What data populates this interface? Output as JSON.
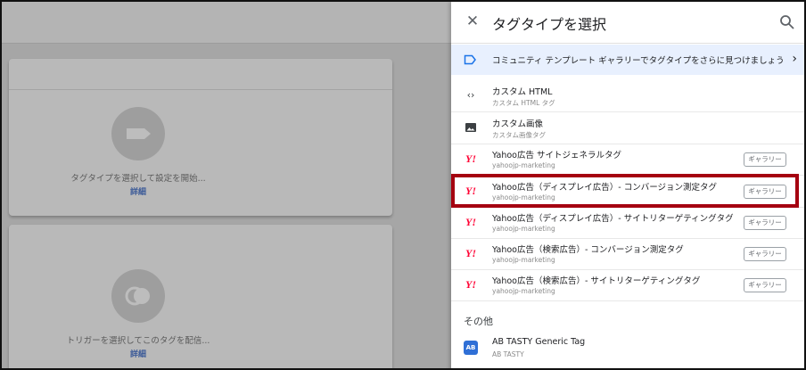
{
  "workspace": {
    "tag_config_card": {
      "text": "タグタイプを選択して設定を開始...",
      "link": "詳細"
    },
    "trigger_card": {
      "text": "トリガーを選択してこのタグを配信...",
      "link": "詳細"
    }
  },
  "panel": {
    "title": "タグタイプを選択",
    "banner": "コミュニティ テンプレート ギャラリーでタグタイプをさらに見つけましょう",
    "items": [
      {
        "name": "カスタム HTML",
        "sub": "カスタム HTML タグ",
        "icon": "code-icon"
      },
      {
        "name": "カスタム画像",
        "sub": "カスタム画像タグ",
        "icon": "image-icon"
      },
      {
        "name": "Yahoo広告 サイトジェネラルタグ",
        "sub": "yahoojp-marketing",
        "icon": "yahoo-icon",
        "badge": "ギャラリー"
      },
      {
        "name": "Yahoo広告（ディスプレイ広告）- コンバージョン測定タグ",
        "sub": "yahoojp-marketing",
        "icon": "yahoo-icon",
        "badge": "ギャラリー"
      },
      {
        "name": "Yahoo広告（ディスプレイ広告）- サイトリターゲティングタグ",
        "sub": "yahoojp-marketing",
        "icon": "yahoo-icon",
        "badge": "ギャラリー"
      },
      {
        "name": "Yahoo広告（検索広告）- コンバージョン測定タグ",
        "sub": "yahoojp-marketing",
        "icon": "yahoo-icon",
        "badge": "ギャラリー"
      },
      {
        "name": "Yahoo広告（検索広告）- サイトリターゲティングタグ",
        "sub": "yahoojp-marketing",
        "icon": "yahoo-icon",
        "badge": "ギャラリー"
      }
    ],
    "section_other": "その他",
    "other_items": [
      {
        "name": "AB TASTY Generic Tag",
        "sub": "AB TASTY",
        "icon": "ab-tasty-icon"
      }
    ]
  },
  "glyphs": {
    "close": "✕",
    "chevron": "›",
    "code": "‹›",
    "yahoo": "Y!",
    "ab": "AB"
  },
  "colors": {
    "highlight": "#a50010",
    "banner_bg": "#e8f0fe",
    "yahoo_red": "#ff0033"
  }
}
